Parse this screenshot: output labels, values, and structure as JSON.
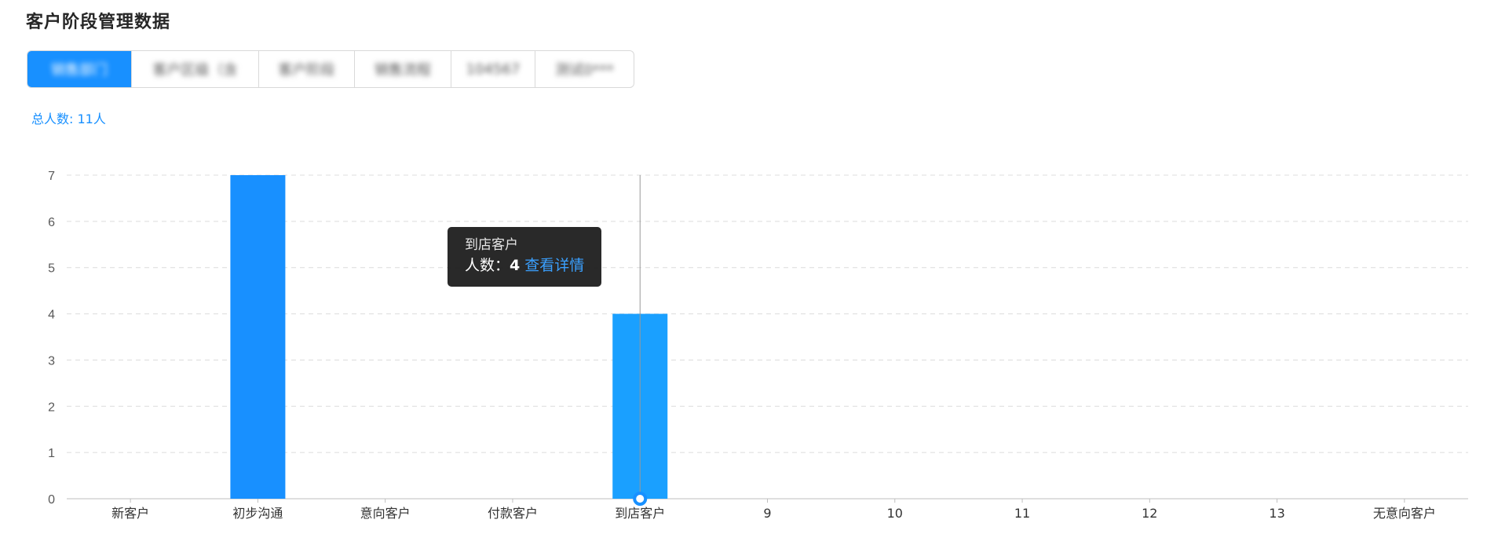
{
  "page": {
    "title": "客户阶段管理数据"
  },
  "tabs": [
    {
      "label": "销售部门",
      "active": true
    },
    {
      "label": "客户区级（含",
      "active": false
    },
    {
      "label": "客户阶段",
      "active": false
    },
    {
      "label": "销售流程",
      "active": false
    },
    {
      "label": "104567",
      "active": false
    },
    {
      "label": "测试0***",
      "active": false
    }
  ],
  "summary": {
    "total_label": "总人数: 11人"
  },
  "tooltip": {
    "title": "到店客户",
    "label": "人数：",
    "value": "4",
    "link_text": "查看详情"
  },
  "chart_data": {
    "type": "bar",
    "categories": [
      "新客户",
      "初步沟通",
      "意向客户",
      "付款客户",
      "到店客户",
      "9",
      "10",
      "11",
      "12",
      "13",
      "无意向客户"
    ],
    "values": [
      0,
      7,
      0,
      0,
      4,
      0,
      0,
      0,
      0,
      0,
      0
    ],
    "ylim": [
      0,
      7
    ],
    "yticks": [
      "0",
      "1",
      "2",
      "3",
      "4",
      "5",
      "6",
      "7"
    ],
    "grid": true,
    "bar_color": "#1890ff",
    "highlight_bar_color": "#1aa0ff",
    "highlight_index": 4
  }
}
